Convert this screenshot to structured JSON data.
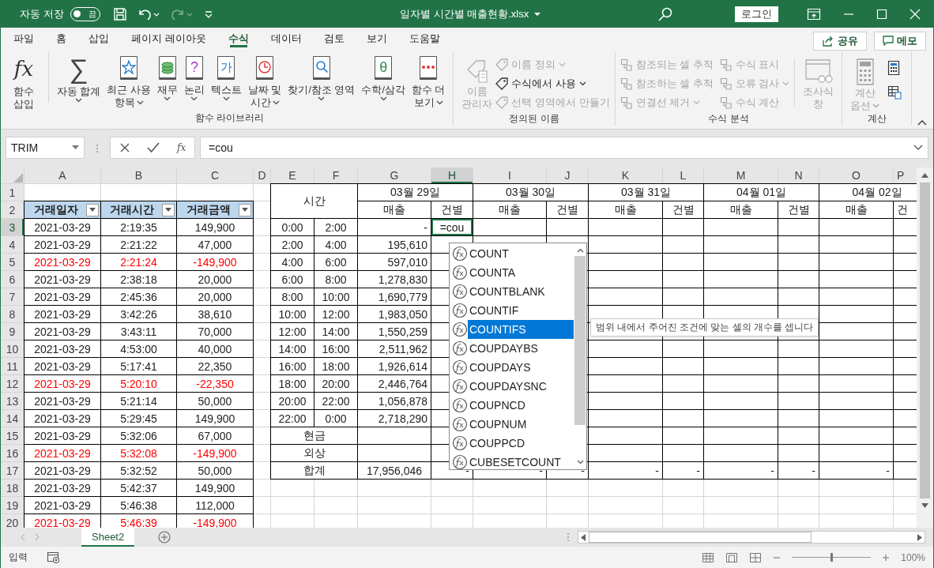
{
  "title_bar": {
    "autosave_label": "자동 저장",
    "autosave_on": false,
    "autosave_state": "끔",
    "file_name": "일자별 시간별 매출현황.xlsx",
    "login": "로그인"
  },
  "ribbon_tabs": [
    {
      "label": "파일",
      "selected": false
    },
    {
      "label": "홈",
      "selected": false
    },
    {
      "label": "삽입",
      "selected": false
    },
    {
      "label": "페이지 레이아웃",
      "selected": false
    },
    {
      "label": "수식",
      "selected": true
    },
    {
      "label": "데이터",
      "selected": false
    },
    {
      "label": "검토",
      "selected": false
    },
    {
      "label": "보기",
      "selected": false
    },
    {
      "label": "도움말",
      "selected": false
    }
  ],
  "ribbon_actions": [
    "공유",
    "메모"
  ],
  "ribbon_groups": [
    {
      "kind": "library",
      "label": "함수 라이브러리",
      "buttons": [
        {
          "lines": [
            "함수",
            "삽입"
          ],
          "glyph": "fx",
          "menu": false
        },
        {
          "lines": [
            "자동 합계"
          ],
          "glyph": "∑",
          "menu": true
        },
        {
          "lines": [
            "최근 사용",
            "항목"
          ],
          "menu": true
        },
        {
          "lines": [
            "재무"
          ],
          "menu": true
        },
        {
          "lines": [
            "논리"
          ],
          "glyph": "?",
          "menu": true
        },
        {
          "lines": [
            "텍스트"
          ],
          "glyph": "가",
          "menu": true
        },
        {
          "lines": [
            "날짜 및",
            "시간"
          ],
          "menu": true
        },
        {
          "lines": [
            "찾기/참조 영역"
          ],
          "menu": true
        },
        {
          "lines": [
            "수학/삼각"
          ],
          "glyph": "θ",
          "menu": true
        },
        {
          "lines": [
            "함수 더",
            "보기"
          ],
          "menu": true
        }
      ]
    },
    {
      "kind": "names",
      "label": "정의된 이름",
      "big": {
        "lines": [
          "이름",
          "관리자"
        ],
        "disabled": true
      },
      "small": [
        {
          "label": "이름 정의",
          "menu": true,
          "disabled": true
        },
        {
          "label": "수식에서 사용",
          "menu": true,
          "disabled": false
        },
        {
          "label": "선택 영역에서 만들기",
          "menu": false,
          "disabled": true
        }
      ]
    },
    {
      "kind": "audit",
      "label": "수식 분석",
      "small": [
        {
          "label": "참조되는 셀 추적",
          "menu": false,
          "disabled": true
        },
        {
          "label": "참조하는 셀 추적",
          "menu": false,
          "disabled": true
        },
        {
          "label": "연결선 제거",
          "menu": true,
          "disabled": true
        },
        {
          "label": "수식 표시",
          "menu": false,
          "disabled": true
        },
        {
          "label": "오류 검사",
          "menu": true,
          "disabled": true
        },
        {
          "label": "수식 계산",
          "menu": false,
          "disabled": true
        }
      ],
      "big": {
        "lines": [
          "조사식",
          "창"
        ],
        "disabled": true
      }
    },
    {
      "kind": "calc",
      "label": "계산",
      "big": {
        "lines": [
          "계산",
          "옵션"
        ],
        "menu": true,
        "disabled": true
      }
    }
  ],
  "formula_bar": {
    "name_box": "TRIM",
    "insert_function": "fx",
    "formula": "=cou"
  },
  "sheet": {
    "columns": [
      {
        "letter": "A",
        "selected": false
      },
      {
        "letter": "B",
        "selected": false
      },
      {
        "letter": "C",
        "selected": false
      },
      {
        "letter": "D",
        "selected": false
      },
      {
        "letter": "E",
        "selected": false
      },
      {
        "letter": "F",
        "selected": false
      },
      {
        "letter": "G",
        "selected": false
      },
      {
        "letter": "H",
        "selected": true
      },
      {
        "letter": "I",
        "selected": false
      },
      {
        "letter": "J",
        "selected": false
      },
      {
        "letter": "K",
        "selected": false
      },
      {
        "letter": "L",
        "selected": false
      },
      {
        "letter": "M",
        "selected": false
      },
      {
        "letter": "N",
        "selected": false
      },
      {
        "letter": "O",
        "selected": false
      },
      {
        "letter": "P",
        "selected": false
      }
    ],
    "row_numbers": [
      {
        "label": "1",
        "selected": false
      },
      {
        "label": "2",
        "selected": false
      },
      {
        "label": "3",
        "selected": true
      },
      {
        "label": "4",
        "selected": false
      },
      {
        "label": "5",
        "selected": false
      },
      {
        "label": "6",
        "selected": false
      },
      {
        "label": "7",
        "selected": false
      },
      {
        "label": "8",
        "selected": false
      },
      {
        "label": "9",
        "selected": false
      },
      {
        "label": "10",
        "selected": false
      },
      {
        "label": "11",
        "selected": false
      },
      {
        "label": "12",
        "selected": false
      },
      {
        "label": "13",
        "selected": false
      },
      {
        "label": "14",
        "selected": false
      },
      {
        "label": "15",
        "selected": false
      },
      {
        "label": "16",
        "selected": false
      },
      {
        "label": "17",
        "selected": false
      },
      {
        "label": "18",
        "selected": false
      },
      {
        "label": "19",
        "selected": false
      },
      {
        "label": "20",
        "selected": false
      }
    ],
    "headers": [
      "거래일자",
      "거래시간",
      "거래금액"
    ],
    "transactions": [
      {
        "date": "2021-03-29",
        "time": "2:19:35",
        "amount": "149,900",
        "negative": false
      },
      {
        "date": "2021-03-29",
        "time": "2:21:22",
        "amount": "47,000",
        "negative": false
      },
      {
        "date": "2021-03-29",
        "time": "2:21:24",
        "amount": "-149,900",
        "negative": true
      },
      {
        "date": "2021-03-29",
        "time": "2:38:18",
        "amount": "20,000",
        "negative": false
      },
      {
        "date": "2021-03-29",
        "time": "2:45:36",
        "amount": "20,000",
        "negative": false
      },
      {
        "date": "2021-03-29",
        "time": "3:42:26",
        "amount": "38,610",
        "negative": false
      },
      {
        "date": "2021-03-29",
        "time": "3:43:11",
        "amount": "70,000",
        "negative": false
      },
      {
        "date": "2021-03-29",
        "time": "4:53:00",
        "amount": "40,000",
        "negative": false
      },
      {
        "date": "2021-03-29",
        "time": "5:17:41",
        "amount": "22,350",
        "negative": false
      },
      {
        "date": "2021-03-29",
        "time": "5:20:10",
        "amount": "-22,350",
        "negative": true
      },
      {
        "date": "2021-03-29",
        "time": "5:21:14",
        "amount": "50,000",
        "negative": false
      },
      {
        "date": "2021-03-29",
        "time": "5:29:45",
        "amount": "149,900",
        "negative": false
      },
      {
        "date": "2021-03-29",
        "time": "5:32:06",
        "amount": "67,000",
        "negative": false
      },
      {
        "date": "2021-03-29",
        "time": "5:32:08",
        "amount": "-149,900",
        "negative": true
      },
      {
        "date": "2021-03-29",
        "time": "5:32:52",
        "amount": "50,000",
        "negative": false
      },
      {
        "date": "2021-03-29",
        "time": "5:42:37",
        "amount": "149,900",
        "negative": false
      },
      {
        "date": "2021-03-29",
        "time": "5:46:38",
        "amount": "112,000",
        "negative": false
      },
      {
        "date": "2021-03-29",
        "time": "5:46:39",
        "amount": "-149,900",
        "negative": true
      }
    ],
    "time_label": "시간",
    "dates": [
      {
        "label": "03월 29일",
        "sales": "매출",
        "count": "건별"
      },
      {
        "label": "03월 30일",
        "sales": "매출",
        "count": "건별"
      },
      {
        "label": "03월 31일",
        "sales": "매출",
        "count": "건별"
      },
      {
        "label": "04월 01일",
        "sales": "매출",
        "count": "건별"
      },
      {
        "label": "04월 02일",
        "sales": "매출",
        "count": "건"
      }
    ],
    "time_rows": [
      {
        "start": "0:00",
        "end": "2:00",
        "sales": "-",
        "editing": "=cou"
      },
      {
        "start": "2:00",
        "end": "4:00",
        "sales": "195,610"
      },
      {
        "start": "4:00",
        "end": "6:00",
        "sales": "597,010"
      },
      {
        "start": "6:00",
        "end": "8:00",
        "sales": "1,278,830"
      },
      {
        "start": "8:00",
        "end": "10:00",
        "sales": "1,690,779"
      },
      {
        "start": "10:00",
        "end": "12:00",
        "sales": "1,983,050"
      },
      {
        "start": "12:00",
        "end": "14:00",
        "sales": "1,550,259"
      },
      {
        "start": "14:00",
        "end": "16:00",
        "sales": "2,511,962"
      },
      {
        "start": "16:00",
        "end": "18:00",
        "sales": "1,926,614"
      },
      {
        "start": "18:00",
        "end": "20:00",
        "sales": "2,446,764"
      },
      {
        "start": "20:00",
        "end": "22:00",
        "sales": "1,056,878"
      },
      {
        "start": "22:00",
        "end": "0:00",
        "sales": "2,718,290"
      }
    ],
    "summary_rows": [
      {
        "label": "현금"
      },
      {
        "label": "외상"
      },
      {
        "label": "합계",
        "total": "17,956,046",
        "dashes": [
          "-",
          "-",
          "-",
          "-",
          "-",
          "-",
          "-",
          "-"
        ]
      }
    ]
  },
  "autocomplete": {
    "items": [
      {
        "name": "COUNT",
        "selected": false
      },
      {
        "name": "COUNTA",
        "selected": false
      },
      {
        "name": "COUNTBLANK",
        "selected": false
      },
      {
        "name": "COUNTIF",
        "selected": false
      },
      {
        "name": "COUNTIFS",
        "selected": true
      },
      {
        "name": "COUPDAYBS",
        "selected": false
      },
      {
        "name": "COUPDAYS",
        "selected": false
      },
      {
        "name": "COUPDAYSNC",
        "selected": false
      },
      {
        "name": "COUPNCD",
        "selected": false
      },
      {
        "name": "COUPNUM",
        "selected": false
      },
      {
        "name": "COUPPCD",
        "selected": false
      },
      {
        "name": "CUBESETCOUNT",
        "selected": false
      }
    ],
    "tooltip": "범위 내에서 주어진 조건에 맞는 셀의 개수를 셉니다"
  },
  "sheet_tabs": [
    {
      "label": "Sheet2",
      "selected": true
    }
  ],
  "status_bar": {
    "mode": "입력",
    "zoom": "100%",
    "zoom_slider": {
      "level": 0.5
    }
  }
}
